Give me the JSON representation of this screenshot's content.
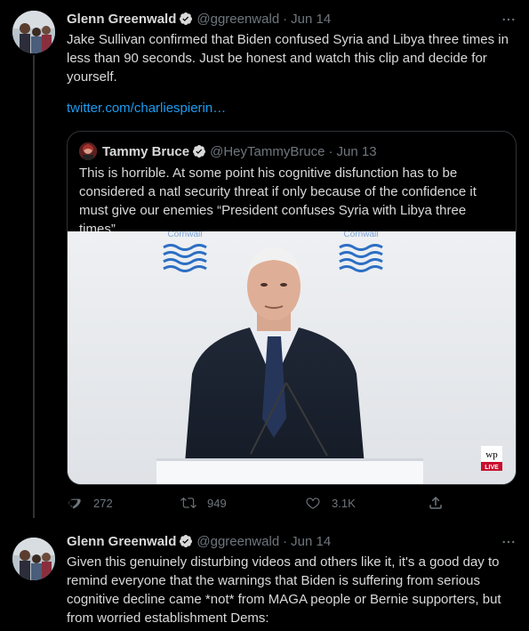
{
  "tweets": [
    {
      "name": "Glenn Greenwald",
      "handle": "@ggreenwald",
      "date": "Jun 14",
      "text": "Jake Sullivan confirmed that Biden confused Syria and Libya three times in less than 90 seconds. Just be honest and watch this clip and decide for yourself.",
      "link": "twitter.com/charliespierin…",
      "quote": {
        "name": "Tammy Bruce",
        "handle": "@HeyTammyBruce",
        "date": "Jun 13",
        "text": "This is horrible. At some point his cognitive disfunction has to be considered a natl security threat if only because of the confidence it must give our enemies “President confuses Syria with Libya three times”",
        "media": {
          "banner_left": "Cornwall",
          "banner_right": "Cornwall",
          "watermark": "wp",
          "live_badge": "LIVE"
        }
      },
      "actions": {
        "replies": "272",
        "retweets": "949",
        "likes": "3.1K"
      }
    },
    {
      "name": "Glenn Greenwald",
      "handle": "@ggreenwald",
      "date": "Jun 14",
      "text": "Given this genuinely disturbing videos and others like it, it's a good day to remind everyone that the warnings that Biden is suffering from serious cognitive decline came *not* from MAGA people or Bernie supporters, but from worried establishment Dems:"
    }
  ],
  "colors": {
    "background": "#000000",
    "text": "#d9d9d9",
    "muted": "#6e767d",
    "link": "#1d9bf0",
    "border": "#2f3336",
    "verified": "#d9d9d9"
  }
}
